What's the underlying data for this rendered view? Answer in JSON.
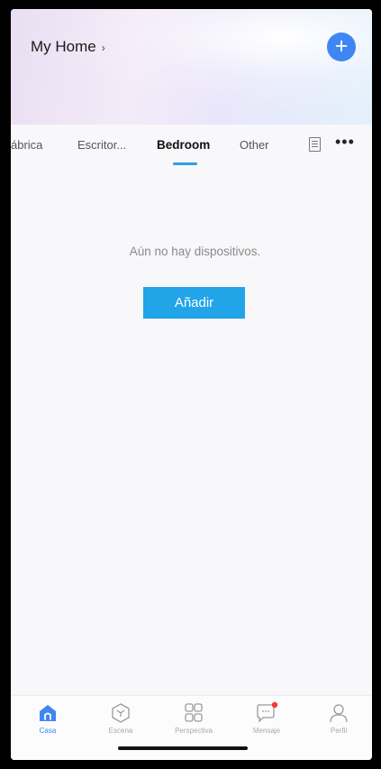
{
  "header": {
    "title": "My Home",
    "chevron": "›",
    "add_icon": "plus-circle-icon",
    "add_symbol": "+"
  },
  "tabs": [
    {
      "label": "ábrica",
      "active": false
    },
    {
      "label": "Escritor...",
      "active": false
    },
    {
      "label": "Bedroom",
      "active": true
    },
    {
      "label": "Other",
      "active": false
    }
  ],
  "toolbar": {
    "list_icon": "list-icon",
    "more_symbol": "•••"
  },
  "empty_state": {
    "message": "Aún no hay dispositivos.",
    "button_label": "Añadir"
  },
  "bottom_nav": [
    {
      "label": "Casa",
      "icon": "house-icon",
      "active": true
    },
    {
      "label": "Escena",
      "icon": "scene-icon",
      "active": false
    },
    {
      "label": "Perspectiva",
      "icon": "grid-icon",
      "active": false
    },
    {
      "label": "Mensaje",
      "icon": "message-icon",
      "active": false,
      "badge": true
    },
    {
      "label": "Perfil",
      "icon": "profile-icon",
      "active": false
    }
  ],
  "colors": {
    "accent": "#3f86f3",
    "button": "#22a4e8",
    "underline": "#2f9fe3",
    "badge": "#f03a3a"
  }
}
